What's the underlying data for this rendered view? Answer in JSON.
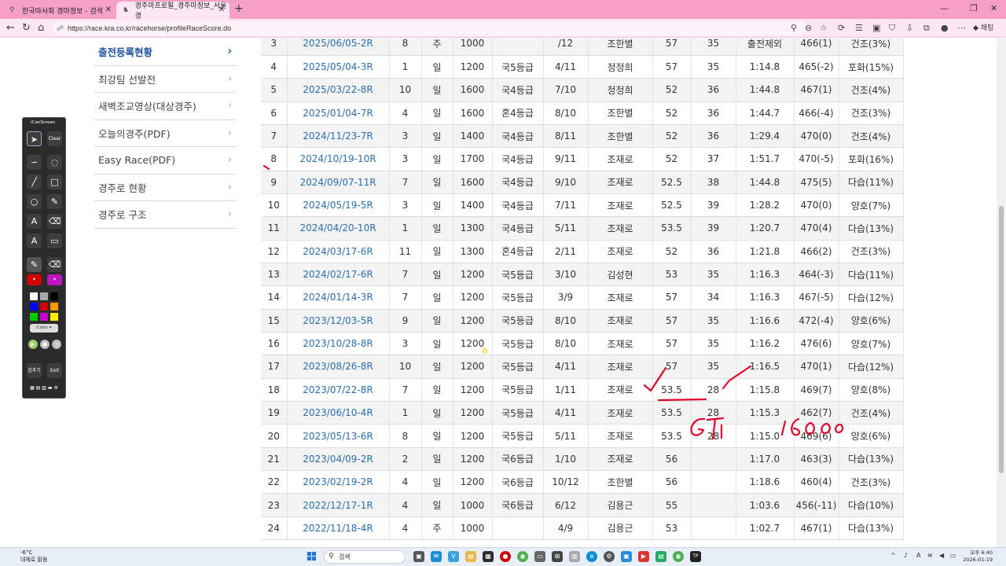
{
  "browser": {
    "tabs": [
      {
        "title": "한국마사회 경마정보 - 검색"
      },
      {
        "title": "경주마프로필_경주마정보_서울경"
      }
    ],
    "url": "https://race.kra.co.kr/racehorse/profileRaceScore.do",
    "chat_label": "채팅"
  },
  "sidebar": {
    "items": [
      {
        "label": "출전등록현황"
      },
      {
        "label": "최강팀 선발전"
      },
      {
        "label": "새벽조교영상(대상경주)"
      },
      {
        "label": "오늘의경주(PDF)"
      },
      {
        "label": "Easy Race(PDF)"
      },
      {
        "label": "경주로 현황"
      },
      {
        "label": "경주로 구조"
      }
    ]
  },
  "rows": [
    {
      "no": "3",
      "date": "2025/06/05-2R",
      "gate": "8",
      "day": "주",
      "dist": "1000",
      "grade": "",
      "rank": "/12",
      "jockey": "조한별",
      "wt": "57",
      "rating": "35",
      "time": "출전제외",
      "body": "466(1)",
      "track": "건조(3%)"
    },
    {
      "no": "4",
      "date": "2025/05/04-3R",
      "gate": "1",
      "day": "일",
      "dist": "1200",
      "grade": "국5등급",
      "rank": "4/11",
      "jockey": "정정희",
      "wt": "57",
      "rating": "35",
      "time": "1:14.8",
      "body": "465(-2)",
      "track": "포화(15%)"
    },
    {
      "no": "5",
      "date": "2025/03/22-8R",
      "gate": "10",
      "day": "일",
      "dist": "1600",
      "grade": "국4등급",
      "rank": "7/10",
      "jockey": "정정희",
      "wt": "52",
      "rating": "36",
      "time": "1:44.8",
      "body": "467(1)",
      "track": "건조(4%)"
    },
    {
      "no": "6",
      "date": "2025/01/04-7R",
      "gate": "4",
      "day": "일",
      "dist": "1600",
      "grade": "혼4등급",
      "rank": "8/10",
      "jockey": "조한별",
      "wt": "52",
      "rating": "36",
      "time": "1:44.7",
      "body": "466(-4)",
      "track": "건조(3%)"
    },
    {
      "no": "7",
      "date": "2024/11/23-7R",
      "gate": "3",
      "day": "일",
      "dist": "1400",
      "grade": "국4등급",
      "rank": "8/11",
      "jockey": "조한별",
      "wt": "52",
      "rating": "36",
      "time": "1:29.4",
      "body": "470(0)",
      "track": "건조(4%)"
    },
    {
      "no": "8",
      "date": "2024/10/19-10R",
      "gate": "3",
      "day": "일",
      "dist": "1700",
      "grade": "국4등급",
      "rank": "9/11",
      "jockey": "조재로",
      "wt": "52",
      "rating": "37",
      "time": "1:51.7",
      "body": "470(-5)",
      "track": "포화(16%)"
    },
    {
      "no": "9",
      "date": "2024/09/07-11R",
      "gate": "7",
      "day": "일",
      "dist": "1600",
      "grade": "국4등급",
      "rank": "9/10",
      "jockey": "조재로",
      "wt": "52.5",
      "rating": "38",
      "time": "1:44.8",
      "body": "475(5)",
      "track": "다습(11%)"
    },
    {
      "no": "10",
      "date": "2024/05/19-5R",
      "gate": "3",
      "day": "일",
      "dist": "1400",
      "grade": "국4등급",
      "rank": "7/11",
      "jockey": "조재로",
      "wt": "52.5",
      "rating": "39",
      "time": "1:28.2",
      "body": "470(0)",
      "track": "양호(7%)"
    },
    {
      "no": "11",
      "date": "2024/04/20-10R",
      "gate": "1",
      "day": "일",
      "dist": "1300",
      "grade": "국4등급",
      "rank": "5/11",
      "jockey": "조재로",
      "wt": "53.5",
      "rating": "39",
      "time": "1:20.7",
      "body": "470(4)",
      "track": "다습(13%)"
    },
    {
      "no": "12",
      "date": "2024/03/17-6R",
      "gate": "11",
      "day": "일",
      "dist": "1300",
      "grade": "혼4등급",
      "rank": "2/11",
      "jockey": "조재로",
      "wt": "52",
      "rating": "36",
      "time": "1:21.8",
      "body": "466(2)",
      "track": "건조(3%)"
    },
    {
      "no": "13",
      "date": "2024/02/17-6R",
      "gate": "7",
      "day": "일",
      "dist": "1200",
      "grade": "국5등급",
      "rank": "3/10",
      "jockey": "김성현",
      "wt": "53",
      "rating": "35",
      "time": "1:16.3",
      "body": "464(-3)",
      "track": "다습(11%)"
    },
    {
      "no": "14",
      "date": "2024/01/14-3R",
      "gate": "7",
      "day": "일",
      "dist": "1200",
      "grade": "국5등급",
      "rank": "3/9",
      "jockey": "조재로",
      "wt": "57",
      "rating": "34",
      "time": "1:16.3",
      "body": "467(-5)",
      "track": "다습(12%)"
    },
    {
      "no": "15",
      "date": "2023/12/03-5R",
      "gate": "9",
      "day": "일",
      "dist": "1200",
      "grade": "국5등급",
      "rank": "8/10",
      "jockey": "조재로",
      "wt": "57",
      "rating": "35",
      "time": "1:16.6",
      "body": "472(-4)",
      "track": "양호(6%)"
    },
    {
      "no": "16",
      "date": "2023/10/28-8R",
      "gate": "3",
      "day": "일",
      "dist": "1200",
      "grade": "국5등급",
      "rank": "8/10",
      "jockey": "조재로",
      "wt": "57",
      "rating": "35",
      "time": "1:16.2",
      "body": "476(6)",
      "track": "양호(7%)"
    },
    {
      "no": "17",
      "date": "2023/08/26-8R",
      "gate": "10",
      "day": "일",
      "dist": "1200",
      "grade": "국5등급",
      "rank": "4/11",
      "jockey": "조재로",
      "wt": "57",
      "rating": "35",
      "time": "1:16.5",
      "body": "470(1)",
      "track": "다습(12%)"
    },
    {
      "no": "18",
      "date": "2023/07/22-8R",
      "gate": "7",
      "day": "일",
      "dist": "1200",
      "grade": "국5등급",
      "rank": "1/11",
      "jockey": "조재로",
      "wt": "53.5",
      "rating": "28",
      "time": "1:15.8",
      "body": "469(7)",
      "track": "양호(8%)"
    },
    {
      "no": "19",
      "date": "2023/06/10-4R",
      "gate": "1",
      "day": "일",
      "dist": "1200",
      "grade": "국5등급",
      "rank": "4/11",
      "jockey": "조재로",
      "wt": "53.5",
      "rating": "28",
      "time": "1:15.3",
      "body": "462(7)",
      "track": "건조(4%)"
    },
    {
      "no": "20",
      "date": "2023/05/13-6R",
      "gate": "8",
      "day": "일",
      "dist": "1200",
      "grade": "국5등급",
      "rank": "5/11",
      "jockey": "조재로",
      "wt": "53.5",
      "rating": "28",
      "time": "1:15.0",
      "body": "469(6)",
      "track": "양호(6%)"
    },
    {
      "no": "21",
      "date": "2023/04/09-2R",
      "gate": "2",
      "day": "일",
      "dist": "1200",
      "grade": "국6등급",
      "rank": "1/10",
      "jockey": "조재로",
      "wt": "56",
      "rating": "",
      "time": "1:17.0",
      "body": "463(3)",
      "track": "다습(13%)"
    },
    {
      "no": "22",
      "date": "2023/02/19-2R",
      "gate": "4",
      "day": "일",
      "dist": "1200",
      "grade": "국6등급",
      "rank": "10/12",
      "jockey": "조한별",
      "wt": "56",
      "rating": "",
      "time": "1:18.6",
      "body": "460(4)",
      "track": "건조(3%)"
    },
    {
      "no": "23",
      "date": "2022/12/17-1R",
      "gate": "4",
      "day": "일",
      "dist": "1000",
      "grade": "국6등급",
      "rank": "6/12",
      "jockey": "김용근",
      "wt": "55",
      "rating": "",
      "time": "1:03.6",
      "body": "456(-11)",
      "track": "다습(10%)"
    },
    {
      "no": "24",
      "date": "2022/11/18-4R",
      "gate": "4",
      "day": "주",
      "dist": "1000",
      "grade": "",
      "rank": "4/9",
      "jockey": "김용근",
      "wt": "53",
      "rating": "",
      "time": "1:02.7",
      "body": "467(1)",
      "track": "다습(13%)"
    }
  ],
  "annotation_tool": {
    "title": "ICanScreen",
    "clear_label": "Clear",
    "record_label": "검추기",
    "exit_label": "Exit",
    "color_label": "Color"
  },
  "taskbar": {
    "weather_temp": "-6°C",
    "weather_desc": "대체로 맑음",
    "search_placeholder": "검색",
    "time": "오후 6:40",
    "date": "2026-01-19"
  },
  "colors": {
    "accent": "#1a4fa0",
    "tabbar": "#f6a0c8",
    "ink": "#e0002a"
  }
}
